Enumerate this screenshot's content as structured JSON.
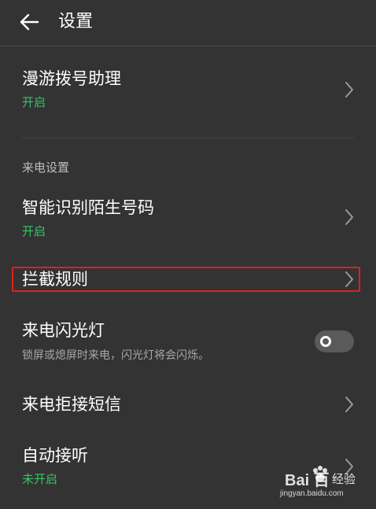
{
  "header": {
    "title": "设置",
    "back_icon": "arrow-left-icon"
  },
  "roaming": {
    "title": "漫游拨号助理",
    "status": "开启"
  },
  "incoming_section": {
    "label": "来电设置"
  },
  "smart_identify": {
    "title": "智能识别陌生号码",
    "status": "开启"
  },
  "block_rules": {
    "title": "拦截规则"
  },
  "flash": {
    "title": "来电闪光灯",
    "description": "锁屏或熄屏时来电，闪光灯将会闪烁。",
    "enabled": false
  },
  "reject_sms": {
    "title": "来电拒接短信"
  },
  "auto_answer": {
    "title": "自动接听",
    "status": "未开启"
  },
  "watermark": {
    "logo": "Bai  百",
    "text": "经验",
    "url": "jingyan.baidu.com"
  },
  "colors": {
    "background": "#333333",
    "status_green": "#35c46a",
    "highlight_red": "#e0201b"
  }
}
